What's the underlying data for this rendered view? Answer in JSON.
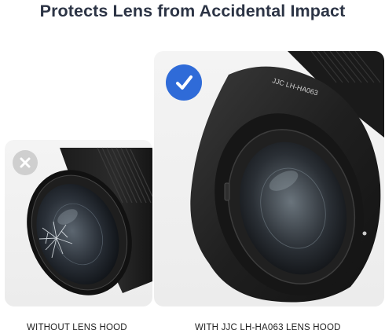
{
  "headline": "Protects Lens from Accidental Impact",
  "panels": {
    "without": {
      "caption": "WITHOUT LENS HOOD",
      "badge_icon": "x-icon",
      "badge_color": "#cfcfcf"
    },
    "with": {
      "caption": "WITH JJC LH-HA063 LENS HOOD",
      "badge_icon": "check-icon",
      "badge_color": "#2f6bd8",
      "hood_marking": "JJC LH-HA063"
    }
  }
}
